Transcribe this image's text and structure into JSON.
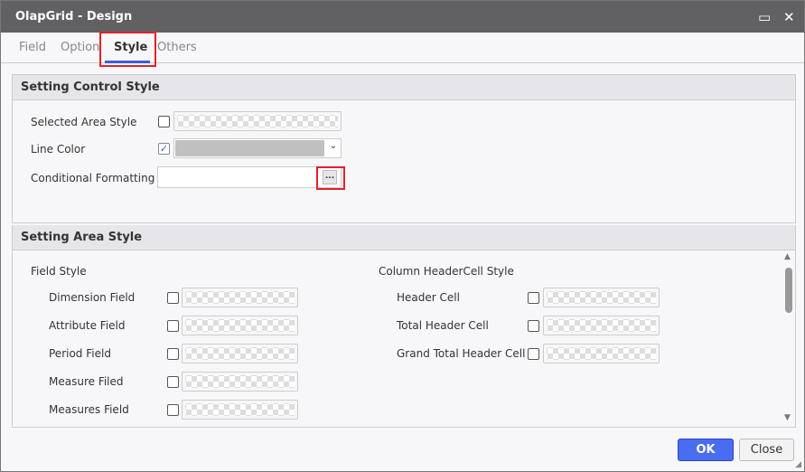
{
  "window": {
    "title": "OlapGrid - Design",
    "maximize_icon": "maximize-icon",
    "close_icon": "close-icon"
  },
  "tabs": [
    {
      "label": "Field"
    },
    {
      "label": "Option"
    },
    {
      "label": "Style",
      "active": true
    },
    {
      "label": "Others"
    }
  ],
  "control_style": {
    "title": "Setting Control Style",
    "selected_area_style": {
      "label": "Selected Area Style",
      "checked": false
    },
    "line_color": {
      "label": "Line Color",
      "checked": true,
      "color": "#c0c0c0"
    },
    "conditional_formatting": {
      "label": "Conditional Formatting",
      "value": "",
      "button": "..."
    }
  },
  "area_style": {
    "title": "Setting Area Style",
    "field_style": {
      "title": "Field Style",
      "items": [
        {
          "label": "Dimension Field"
        },
        {
          "label": "Attribute Field"
        },
        {
          "label": "Period Field"
        },
        {
          "label": "Measure Filed"
        },
        {
          "label": "Measures Field"
        }
      ]
    },
    "column_header_style": {
      "title": "Column HeaderCell Style",
      "items": [
        {
          "label": "Header Cell"
        },
        {
          "label": "Total Header Cell"
        },
        {
          "label": "Grand Total Header Cell"
        }
      ]
    }
  },
  "buttons": {
    "ok": "OK",
    "close": "Close"
  },
  "colors": {
    "accent": "#3d5be0",
    "highlight": "#e5202a",
    "titlebar": "#616163"
  }
}
